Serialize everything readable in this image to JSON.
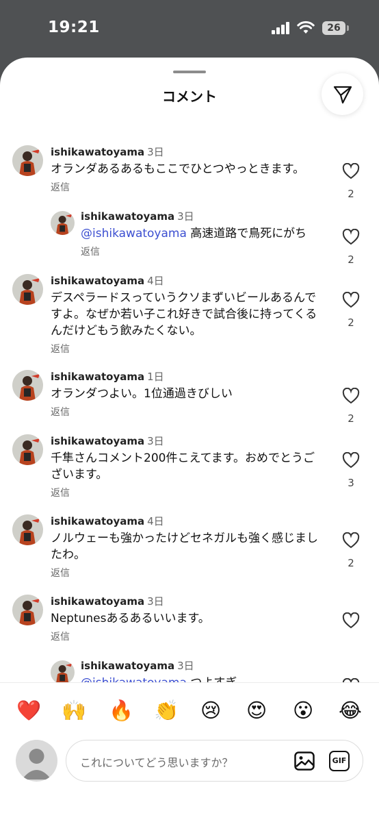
{
  "status_bar": {
    "time": "19:21",
    "battery": "26"
  },
  "sheet": {
    "title": "コメント"
  },
  "comments": [
    {
      "user": "ishikawatoyama",
      "time": "3日",
      "text": "オランダあるあるもここでひとつやっときます。",
      "reply_label": "返信",
      "likes": "2"
    },
    {
      "user": "ishikawatoyama",
      "time": "3日",
      "mention": "@ishikawatoyama",
      "text": "高速道路で鳥死にがち",
      "reply_label": "返信",
      "likes": "2"
    },
    {
      "user": "ishikawatoyama",
      "time": "4日",
      "text": "デスペラードスっていうクソまずいビールあるんですよ。なぜか若い子これ好きで試合後に持ってくるんだけどもう飲みたくない。",
      "reply_label": "返信",
      "likes": "2"
    },
    {
      "user": "ishikawatoyama",
      "time": "1日",
      "text": "オランダつよい。1位通過きびしい",
      "reply_label": "返信",
      "likes": "2"
    },
    {
      "user": "ishikawatoyama",
      "time": "3日",
      "text": "千隼さんコメント200件こえてます。おめでとうございます。",
      "reply_label": "返信",
      "likes": "3"
    },
    {
      "user": "ishikawatoyama",
      "time": "4日",
      "text": "ノルウェーも強かったけどセネガルも強く感じましたわ。",
      "reply_label": "返信",
      "likes": "2"
    },
    {
      "user": "ishikawatoyama",
      "time": "3日",
      "text": "Neptunesあるあるいいます。",
      "reply_label": "返信"
    },
    {
      "user": "ishikawatoyama",
      "time": "3日",
      "mention": "@ishikawatoyama",
      "text": "つよすぎ"
    }
  ],
  "emoji_reactions": [
    "❤️",
    "🙌",
    "🔥",
    "👏",
    "😢",
    "😍",
    "😮",
    "😂"
  ],
  "composer": {
    "placeholder": "これについてどう思いますか？",
    "gif_label": "GIF"
  }
}
